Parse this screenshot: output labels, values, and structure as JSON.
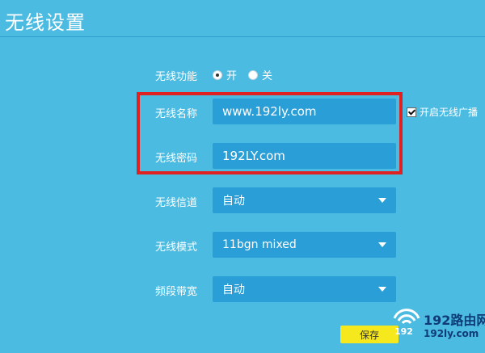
{
  "page": {
    "title": "无线设置"
  },
  "wireless_function": {
    "label": "无线功能",
    "options": [
      {
        "label": "开",
        "checked": true
      },
      {
        "label": "关",
        "checked": false
      }
    ]
  },
  "wireless_name": {
    "label": "无线名称",
    "value": "www.192ly.com"
  },
  "broadcast": {
    "label": "开启无线广播",
    "checked": true
  },
  "wireless_password": {
    "label": "无线密码",
    "value": "192LY.com"
  },
  "channel": {
    "label": "无线信道",
    "value": "自动"
  },
  "mode": {
    "label": "无线模式",
    "value": "11bgn mixed"
  },
  "bandwidth": {
    "label": "频段带宽",
    "value": "自动"
  },
  "actions": {
    "save_label": "保存"
  },
  "watermark": {
    "top_text": "192路由网",
    "bottom_text": "192ly.com",
    "logo_text": "192"
  },
  "colors": {
    "background": "#4bbbe1",
    "field": "#2a9ed7",
    "highlight": "#e02121",
    "save_button": "#f5e81c",
    "watermark": "#0f3b78"
  }
}
